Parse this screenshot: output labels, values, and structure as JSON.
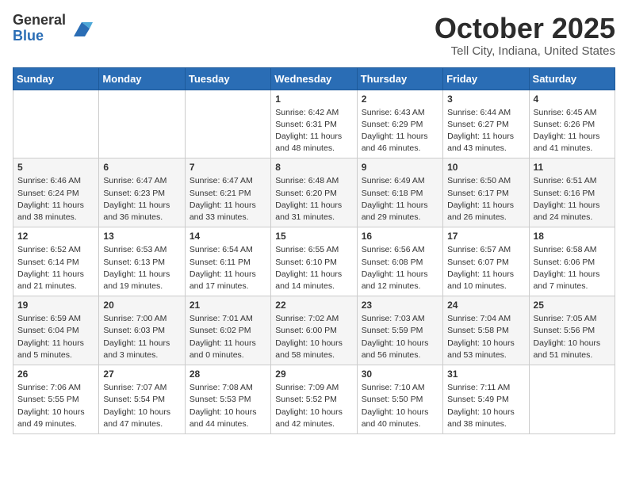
{
  "logo": {
    "general": "General",
    "blue": "Blue"
  },
  "title": "October 2025",
  "subtitle": "Tell City, Indiana, United States",
  "days_header": [
    "Sunday",
    "Monday",
    "Tuesday",
    "Wednesday",
    "Thursday",
    "Friday",
    "Saturday"
  ],
  "weeks": [
    [
      {
        "num": "",
        "info": ""
      },
      {
        "num": "",
        "info": ""
      },
      {
        "num": "",
        "info": ""
      },
      {
        "num": "1",
        "info": "Sunrise: 6:42 AM\nSunset: 6:31 PM\nDaylight: 11 hours and 48 minutes."
      },
      {
        "num": "2",
        "info": "Sunrise: 6:43 AM\nSunset: 6:29 PM\nDaylight: 11 hours and 46 minutes."
      },
      {
        "num": "3",
        "info": "Sunrise: 6:44 AM\nSunset: 6:27 PM\nDaylight: 11 hours and 43 minutes."
      },
      {
        "num": "4",
        "info": "Sunrise: 6:45 AM\nSunset: 6:26 PM\nDaylight: 11 hours and 41 minutes."
      }
    ],
    [
      {
        "num": "5",
        "info": "Sunrise: 6:46 AM\nSunset: 6:24 PM\nDaylight: 11 hours and 38 minutes."
      },
      {
        "num": "6",
        "info": "Sunrise: 6:47 AM\nSunset: 6:23 PM\nDaylight: 11 hours and 36 minutes."
      },
      {
        "num": "7",
        "info": "Sunrise: 6:47 AM\nSunset: 6:21 PM\nDaylight: 11 hours and 33 minutes."
      },
      {
        "num": "8",
        "info": "Sunrise: 6:48 AM\nSunset: 6:20 PM\nDaylight: 11 hours and 31 minutes."
      },
      {
        "num": "9",
        "info": "Sunrise: 6:49 AM\nSunset: 6:18 PM\nDaylight: 11 hours and 29 minutes."
      },
      {
        "num": "10",
        "info": "Sunrise: 6:50 AM\nSunset: 6:17 PM\nDaylight: 11 hours and 26 minutes."
      },
      {
        "num": "11",
        "info": "Sunrise: 6:51 AM\nSunset: 6:16 PM\nDaylight: 11 hours and 24 minutes."
      }
    ],
    [
      {
        "num": "12",
        "info": "Sunrise: 6:52 AM\nSunset: 6:14 PM\nDaylight: 11 hours and 21 minutes."
      },
      {
        "num": "13",
        "info": "Sunrise: 6:53 AM\nSunset: 6:13 PM\nDaylight: 11 hours and 19 minutes."
      },
      {
        "num": "14",
        "info": "Sunrise: 6:54 AM\nSunset: 6:11 PM\nDaylight: 11 hours and 17 minutes."
      },
      {
        "num": "15",
        "info": "Sunrise: 6:55 AM\nSunset: 6:10 PM\nDaylight: 11 hours and 14 minutes."
      },
      {
        "num": "16",
        "info": "Sunrise: 6:56 AM\nSunset: 6:08 PM\nDaylight: 11 hours and 12 minutes."
      },
      {
        "num": "17",
        "info": "Sunrise: 6:57 AM\nSunset: 6:07 PM\nDaylight: 11 hours and 10 minutes."
      },
      {
        "num": "18",
        "info": "Sunrise: 6:58 AM\nSunset: 6:06 PM\nDaylight: 11 hours and 7 minutes."
      }
    ],
    [
      {
        "num": "19",
        "info": "Sunrise: 6:59 AM\nSunset: 6:04 PM\nDaylight: 11 hours and 5 minutes."
      },
      {
        "num": "20",
        "info": "Sunrise: 7:00 AM\nSunset: 6:03 PM\nDaylight: 11 hours and 3 minutes."
      },
      {
        "num": "21",
        "info": "Sunrise: 7:01 AM\nSunset: 6:02 PM\nDaylight: 11 hours and 0 minutes."
      },
      {
        "num": "22",
        "info": "Sunrise: 7:02 AM\nSunset: 6:00 PM\nDaylight: 10 hours and 58 minutes."
      },
      {
        "num": "23",
        "info": "Sunrise: 7:03 AM\nSunset: 5:59 PM\nDaylight: 10 hours and 56 minutes."
      },
      {
        "num": "24",
        "info": "Sunrise: 7:04 AM\nSunset: 5:58 PM\nDaylight: 10 hours and 53 minutes."
      },
      {
        "num": "25",
        "info": "Sunrise: 7:05 AM\nSunset: 5:56 PM\nDaylight: 10 hours and 51 minutes."
      }
    ],
    [
      {
        "num": "26",
        "info": "Sunrise: 7:06 AM\nSunset: 5:55 PM\nDaylight: 10 hours and 49 minutes."
      },
      {
        "num": "27",
        "info": "Sunrise: 7:07 AM\nSunset: 5:54 PM\nDaylight: 10 hours and 47 minutes."
      },
      {
        "num": "28",
        "info": "Sunrise: 7:08 AM\nSunset: 5:53 PM\nDaylight: 10 hours and 44 minutes."
      },
      {
        "num": "29",
        "info": "Sunrise: 7:09 AM\nSunset: 5:52 PM\nDaylight: 10 hours and 42 minutes."
      },
      {
        "num": "30",
        "info": "Sunrise: 7:10 AM\nSunset: 5:50 PM\nDaylight: 10 hours and 40 minutes."
      },
      {
        "num": "31",
        "info": "Sunrise: 7:11 AM\nSunset: 5:49 PM\nDaylight: 10 hours and 38 minutes."
      },
      {
        "num": "",
        "info": ""
      }
    ]
  ]
}
